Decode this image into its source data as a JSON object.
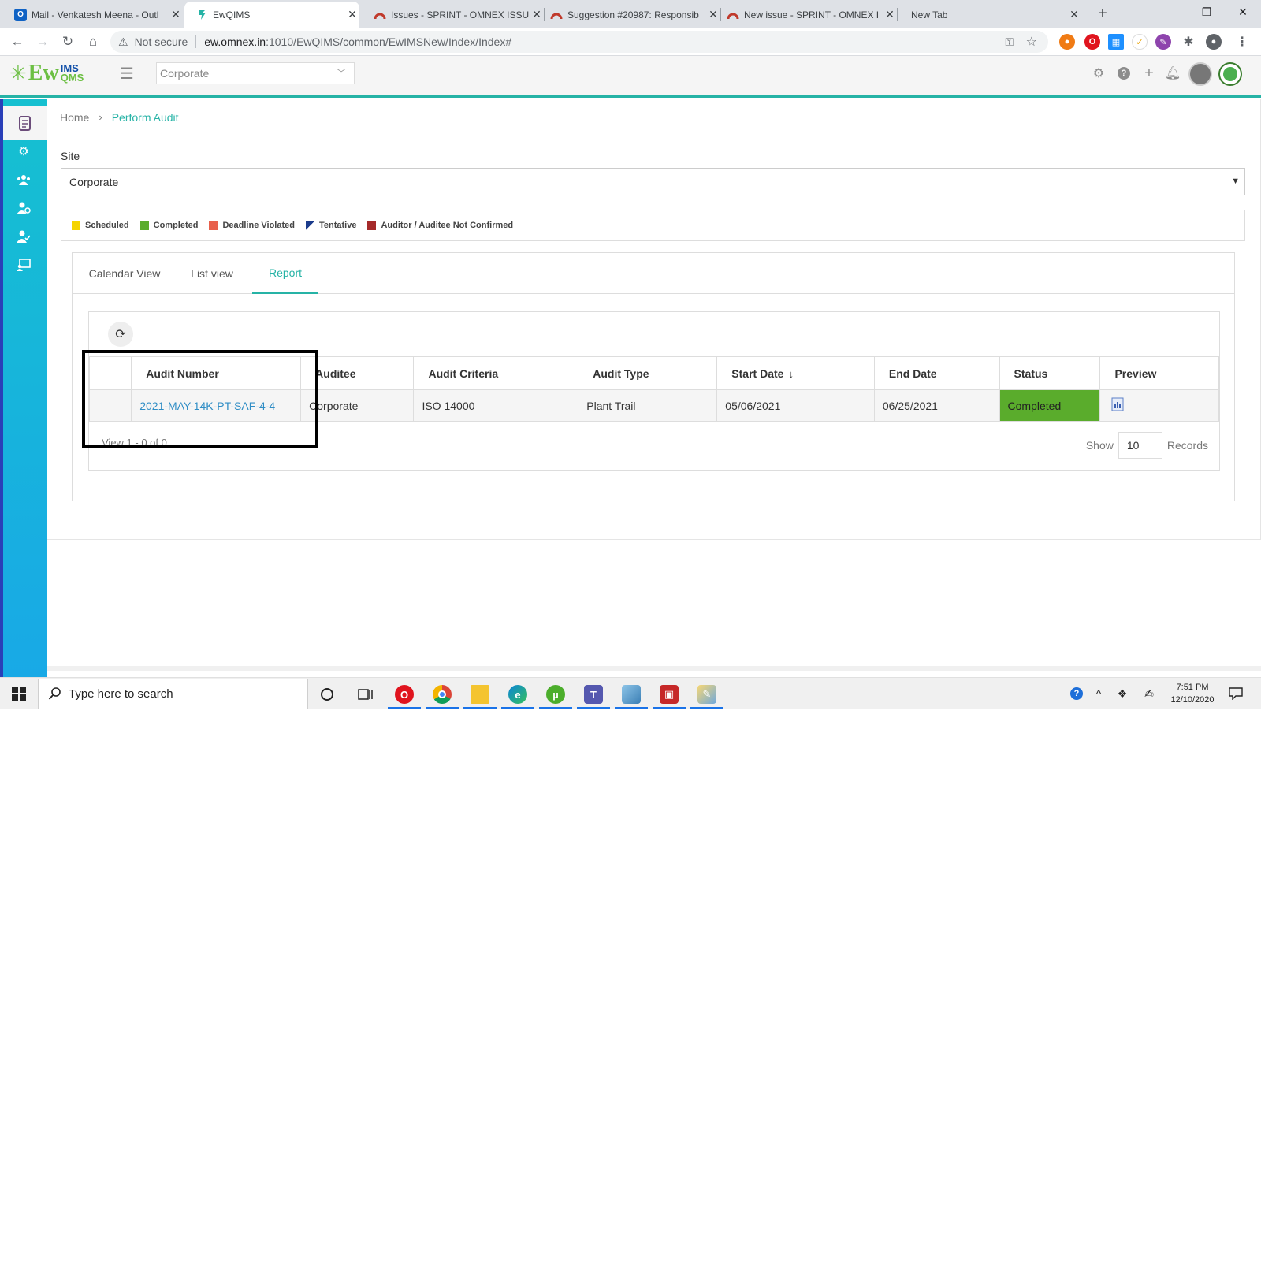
{
  "browser": {
    "tabs": [
      {
        "label": "Mail - Venkatesh Meena - Outl",
        "icon": "outlook-icon",
        "active": false
      },
      {
        "label": "EwQIMS",
        "icon": "ewqims-icon",
        "active": true
      },
      {
        "label": "Issues - SPRINT - OMNEX ISSU",
        "icon": "redmine-icon",
        "active": false
      },
      {
        "label": "Suggestion #20987: Responsib",
        "icon": "redmine-icon",
        "active": false
      },
      {
        "label": "New issue - SPRINT - OMNEX I",
        "icon": "redmine-icon",
        "active": false
      },
      {
        "label": "New Tab",
        "icon": "",
        "active": false
      }
    ],
    "new_tab_glyph": "+",
    "window_controls": {
      "minimize": "–",
      "restore": "❐",
      "close": "✕"
    },
    "security_label": "Not secure",
    "url_host": "ew.omnex.in",
    "url_rest": ":1010/EwQIMS/common/EwIMSNew/Index/Index#"
  },
  "app": {
    "logo_main": "Ew",
    "logo_top": "IMS",
    "logo_bottom": "QMS",
    "site_dropdown_top": "Corporate",
    "menu_glyph": "☰"
  },
  "breadcrumb": {
    "home": "Home",
    "separator": "›",
    "current": "Perform Audit"
  },
  "site": {
    "label": "Site",
    "value": "Corporate"
  },
  "legend": [
    {
      "label": "Scheduled",
      "color": "#f5d400"
    },
    {
      "label": "Completed",
      "color": "#5aac2c"
    },
    {
      "label": "Deadline Violated",
      "color": "#e8604c"
    },
    {
      "label": "Tentative",
      "color": "#1b3c8c"
    },
    {
      "label": "Auditor / Auditee Not Confirmed",
      "color": "#a52a2a"
    }
  ],
  "view_tabs": [
    {
      "label": "Calendar View",
      "active": false
    },
    {
      "label": "List view",
      "active": false
    },
    {
      "label": "Report",
      "active": true
    }
  ],
  "grid": {
    "columns": [
      "",
      "Audit Number",
      "Auditee",
      "Audit Criteria",
      "Audit Type",
      "Start Date",
      "End Date",
      "Status",
      "Preview"
    ],
    "sort_indicator": "↓",
    "rows": [
      {
        "audit_number": "2021-MAY-14K-PT-SAF-4-4",
        "auditee": "Corporate",
        "criteria": "ISO 14000",
        "type": "Plant Trail",
        "start": "05/06/2021",
        "end": "06/25/2021",
        "status": "Completed"
      }
    ],
    "footer_view": "View 1 - 0 of 0",
    "show_label": "Show",
    "page_size": "10",
    "records_label": "Records"
  },
  "taskbar": {
    "search_placeholder": "Type here to search",
    "time": "7:51 PM",
    "date": "12/10/2020"
  },
  "colors": {
    "accent": "#26b3a6",
    "completed": "#5aac2c",
    "link": "#2f8dc5"
  }
}
